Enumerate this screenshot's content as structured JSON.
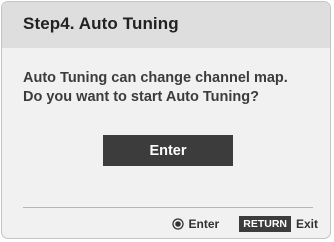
{
  "dialog": {
    "title": "Step4. Auto Tuning",
    "message": {
      "line1": "Auto Tuning can change channel map.",
      "line2": "Do you want to start Auto Tuning?"
    },
    "enter_button_label": "Enter"
  },
  "footer": {
    "ok_icon": "ok-circle-icon",
    "enter_hint_label": "Enter",
    "return_key_label": "RETURN",
    "exit_hint_label": "Exit"
  },
  "colors": {
    "title_bar": "#dedede",
    "panel": "#f1f1f1",
    "button": "#3c3c3c",
    "button_text": "#ffffff"
  }
}
